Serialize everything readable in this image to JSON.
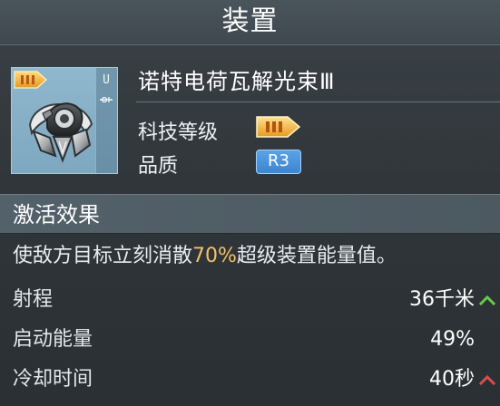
{
  "window": {
    "title": "装置"
  },
  "item": {
    "name": "诺特电荷瓦解光束Ⅲ",
    "icon_tier": "III",
    "icon_side_label": "U",
    "equipment_icon": "energy-disruptor-module-icon",
    "tech_level_label": "科技等级",
    "tech_level_value": "III",
    "quality_label": "品质",
    "quality_value": "R3"
  },
  "section": {
    "title": "激活效果"
  },
  "effect": {
    "prefix": "使敌方目标立刻消散",
    "highlight": "70%",
    "suffix": "超级装置能量值。"
  },
  "attributes": [
    {
      "label": "射程",
      "value": "36千米",
      "trend": "up"
    },
    {
      "label": "启动能量",
      "value": "49%",
      "trend": "none"
    },
    {
      "label": "冷却时间",
      "value": "40秒",
      "trend": "up"
    }
  ],
  "colors": {
    "highlight": "#f1c16a",
    "up_green": "#67c84a",
    "up_red": "#d84c4c",
    "tier_gold": "#f1b43c",
    "rarity_blue": "#4b94dc"
  }
}
